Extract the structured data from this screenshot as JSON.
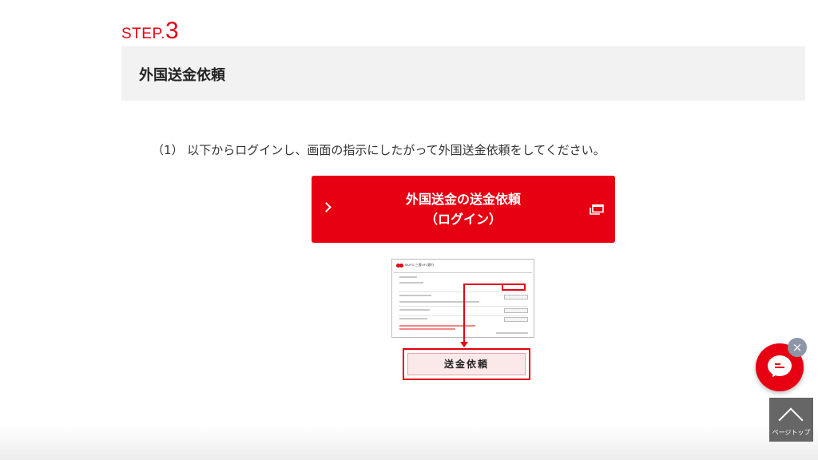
{
  "step": {
    "word": "STEP.",
    "number": "3"
  },
  "section": {
    "title": "外国送金依頼"
  },
  "instruction": "（1） 以下からログインし、画面の指示にしたがって外国送金依頼をしてください。",
  "login_button": {
    "line1": "外国送金の送金依頼",
    "line2": "（ログイン）",
    "icon": "new-window-icon"
  },
  "illustration": {
    "bank_name": "MUFG 三菱UFJ銀行",
    "callout_button": "送金依頼"
  },
  "chat": {
    "icon": "chat-icon",
    "close_label": "×"
  },
  "page_top": {
    "label": "ページトップ",
    "icon": "chevron-up-icon"
  },
  "colors": {
    "brand": "#e60012",
    "header_bg": "#f2f2f2",
    "pagetop_bg": "#666666"
  }
}
